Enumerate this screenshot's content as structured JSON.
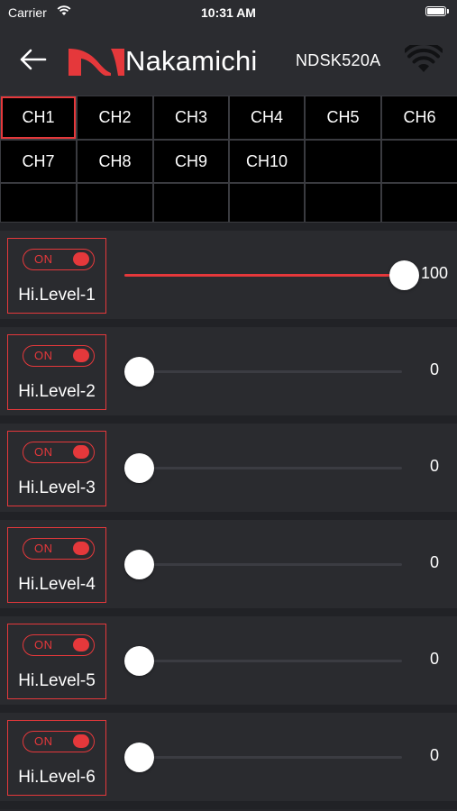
{
  "status_bar": {
    "carrier": "Carrier",
    "time": "10:31 AM",
    "wifi_icon": "wifi-signal-icon",
    "battery_icon": "battery-full-icon"
  },
  "header": {
    "back_icon": "arrow-left-icon",
    "logo_text": "Nakamichi",
    "logo_mark_color": "#e5383b",
    "device_name": "NDSK520A",
    "wifi_icon": "wifi-icon"
  },
  "channels": {
    "selected": "CH1",
    "rows": [
      [
        "CH1",
        "CH2",
        "CH3",
        "CH4",
        "CH5",
        "CH6"
      ],
      [
        "CH7",
        "CH8",
        "CH9",
        "CH10",
        "",
        ""
      ],
      [
        "",
        "",
        "",
        "",
        "",
        ""
      ]
    ]
  },
  "levels": [
    {
      "label": "Hi.Level-1",
      "toggle": "ON",
      "value": "100",
      "fraction": 1.0
    },
    {
      "label": "Hi.Level-2",
      "toggle": "ON",
      "value": "0",
      "fraction": 0.0
    },
    {
      "label": "Hi.Level-3",
      "toggle": "ON",
      "value": "0",
      "fraction": 0.0
    },
    {
      "label": "Hi.Level-4",
      "toggle": "ON",
      "value": "0",
      "fraction": 0.0
    },
    {
      "label": "Hi.Level-5",
      "toggle": "ON",
      "value": "0",
      "fraction": 0.0
    },
    {
      "label": "Hi.Level-6",
      "toggle": "ON",
      "value": "0",
      "fraction": 0.0
    }
  ],
  "colors": {
    "accent": "#e5383b",
    "background": "#26272b",
    "cell": "#000000"
  }
}
